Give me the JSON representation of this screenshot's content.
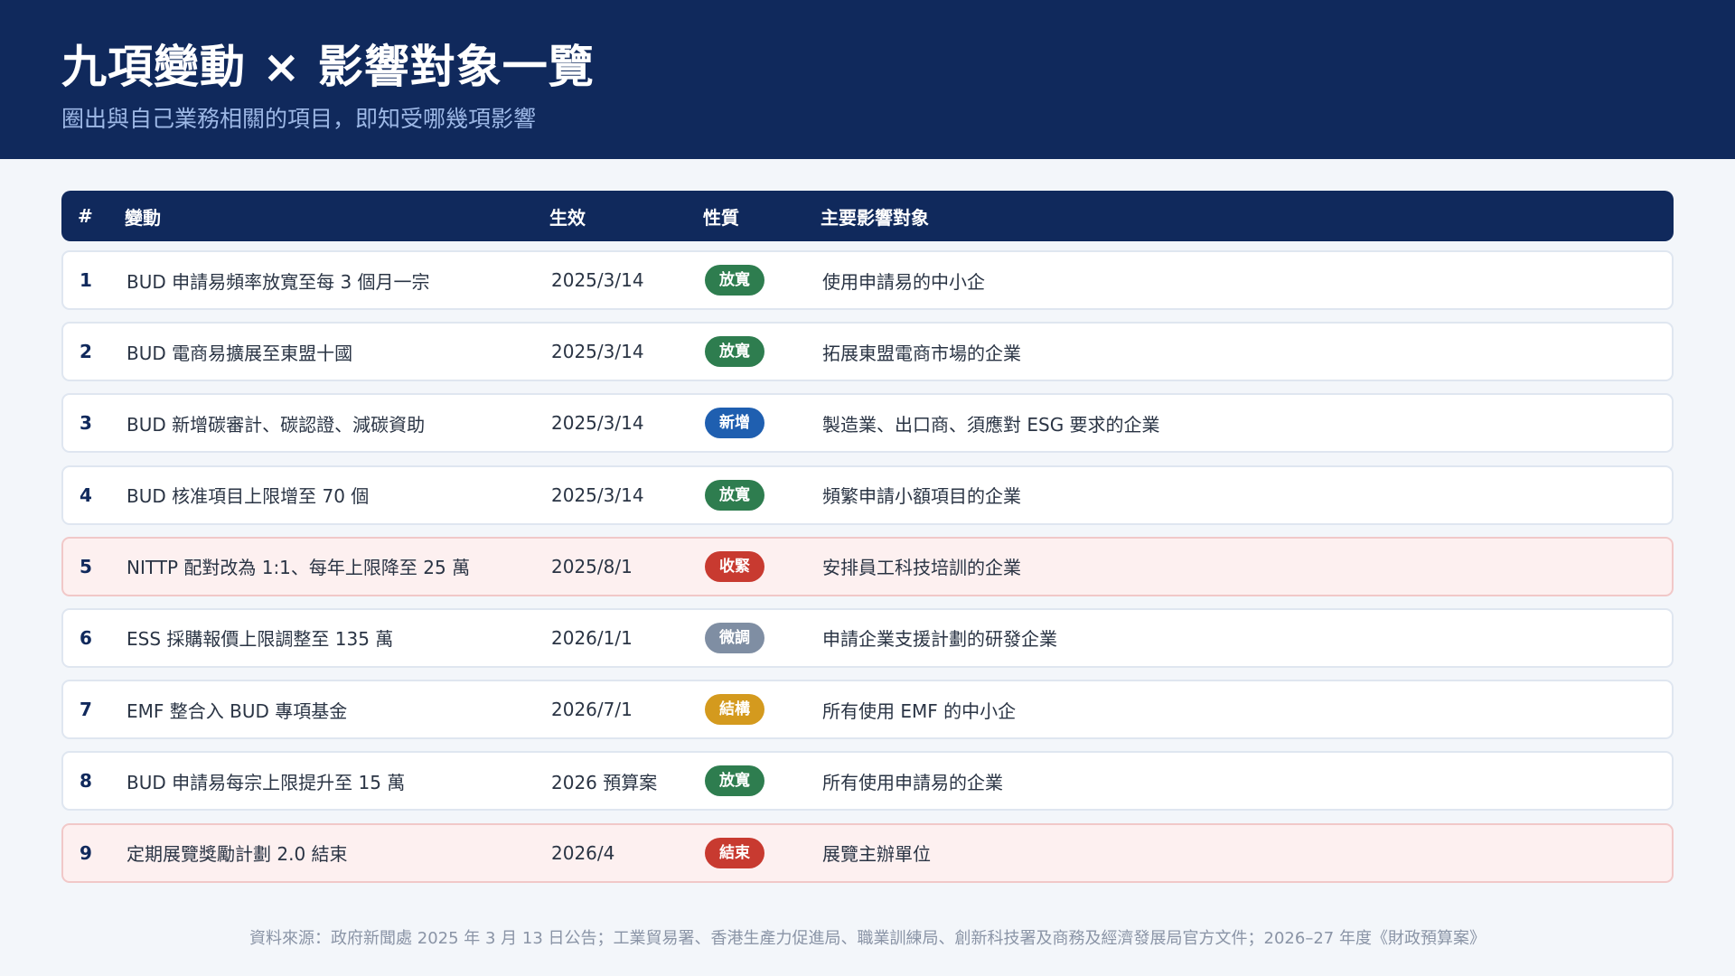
{
  "header": {
    "title": "九項變動 × 影響對象一覽",
    "subtitle": "圈出與自己業務相關的項目，即知受哪幾項影響"
  },
  "table": {
    "columns": [
      "#",
      "變動",
      "生效",
      "性質",
      "主要影響對象"
    ],
    "rows": [
      {
        "num": "1",
        "change": "BUD 申請易頻率放寬至每 3 個月一宗",
        "effective": "2025/3/14",
        "nature": "放寬",
        "nature_color": "#2e7d4f",
        "target": "使用申請易的中小企",
        "highlight": false
      },
      {
        "num": "2",
        "change": "BUD 電商易擴展至東盟十國",
        "effective": "2025/3/14",
        "nature": "放寬",
        "nature_color": "#2e7d4f",
        "target": "拓展東盟電商市場的企業",
        "highlight": false
      },
      {
        "num": "3",
        "change": "BUD 新增碳審計、碳認證、減碳資助",
        "effective": "2025/3/14",
        "nature": "新增",
        "nature_color": "#1f5fb0",
        "target": "製造業、出口商、須應對 ESG 要求的企業",
        "highlight": false
      },
      {
        "num": "4",
        "change": "BUD 核准項目上限增至 70 個",
        "effective": "2025/3/14",
        "nature": "放寬",
        "nature_color": "#2e7d4f",
        "target": "頻繁申請小額項目的企業",
        "highlight": false
      },
      {
        "num": "5",
        "change": "NITTP 配對改為 1:1、每年上限降至 25 萬",
        "effective": "2025/8/1",
        "nature": "收緊",
        "nature_color": "#c83a30",
        "target": "安排員工科技培訓的企業",
        "highlight": true
      },
      {
        "num": "6",
        "change": "ESS 採購報價上限調整至 135 萬",
        "effective": "2026/1/1",
        "nature": "微調",
        "nature_color": "#7f8ea3",
        "target": "申請企業支援計劃的研發企業",
        "highlight": false
      },
      {
        "num": "7",
        "change": "EMF 整合入 BUD 專項基金",
        "effective": "2026/7/1",
        "nature": "結構",
        "nature_color": "#d49a1e",
        "target": "所有使用 EMF 的中小企",
        "highlight": false
      },
      {
        "num": "8",
        "change": "BUD 申請易每宗上限提升至 15 萬",
        "effective": "2026 預算案",
        "nature": "放寬",
        "nature_color": "#2e7d4f",
        "target": "所有使用申請易的企業",
        "highlight": false
      },
      {
        "num": "9",
        "change": "定期展覽獎勵計劃 2.0 結束",
        "effective": "2026/4",
        "nature": "結束",
        "nature_color": "#c83a30",
        "target": "展覽主辦單位",
        "highlight": true
      }
    ]
  },
  "footer": {
    "source": "資料來源：政府新聞處 2025 年 3 月 13 日公告；工業貿易署、香港生產力促進局、職業訓練局、創新科技署及商務及經濟發展局官方文件；2026–27 年度《財政預算案》"
  }
}
